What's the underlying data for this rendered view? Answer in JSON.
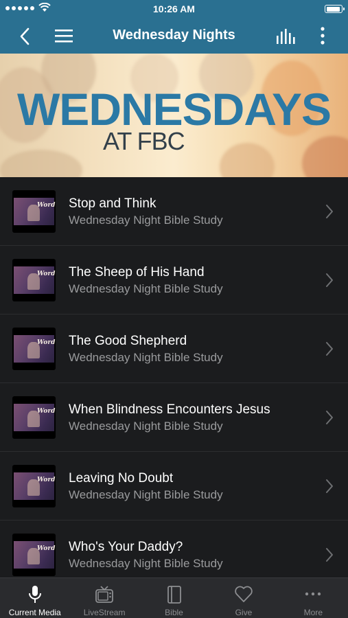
{
  "status_bar": {
    "time": "10:26 AM"
  },
  "nav": {
    "title": "Wednesday Nights",
    "icons": [
      "chevron-left-icon",
      "hamburger-menu-icon",
      "audio-bars-icon",
      "vertical-more-icon"
    ]
  },
  "banner": {
    "title": "WEDNESDAYS",
    "subtitle": "AT FBC"
  },
  "items": [
    {
      "title": "Stop and Think",
      "subtitle": "Wednesday Night Bible Study"
    },
    {
      "title": "The Sheep of His Hand",
      "subtitle": "Wednesday Night Bible Study"
    },
    {
      "title": "The Good Shepherd",
      "subtitle": "Wednesday Night Bible Study"
    },
    {
      "title": "When Blindness Encounters Jesus",
      "subtitle": "Wednesday Night Bible Study"
    },
    {
      "title": "Leaving No Doubt",
      "subtitle": "Wednesday Night Bible Study"
    },
    {
      "title": "Who's Your Daddy?",
      "subtitle": "Wednesday Night Bible Study"
    }
  ],
  "thumbnail_text": "Word",
  "tabs": [
    {
      "label": "Current Media",
      "icon": "microphone-icon",
      "active": true
    },
    {
      "label": "LiveStream",
      "icon": "tv-icon",
      "active": false
    },
    {
      "label": "Bible",
      "icon": "book-icon",
      "active": false
    },
    {
      "label": "Give",
      "icon": "heart-icon",
      "active": false
    },
    {
      "label": "More",
      "icon": "more-dots-icon",
      "active": false
    }
  ],
  "colors": {
    "header": "#2a7091",
    "background": "#1b1c1e",
    "tab_bar": "#2a2b2e",
    "banner_title": "#2b79a5"
  }
}
